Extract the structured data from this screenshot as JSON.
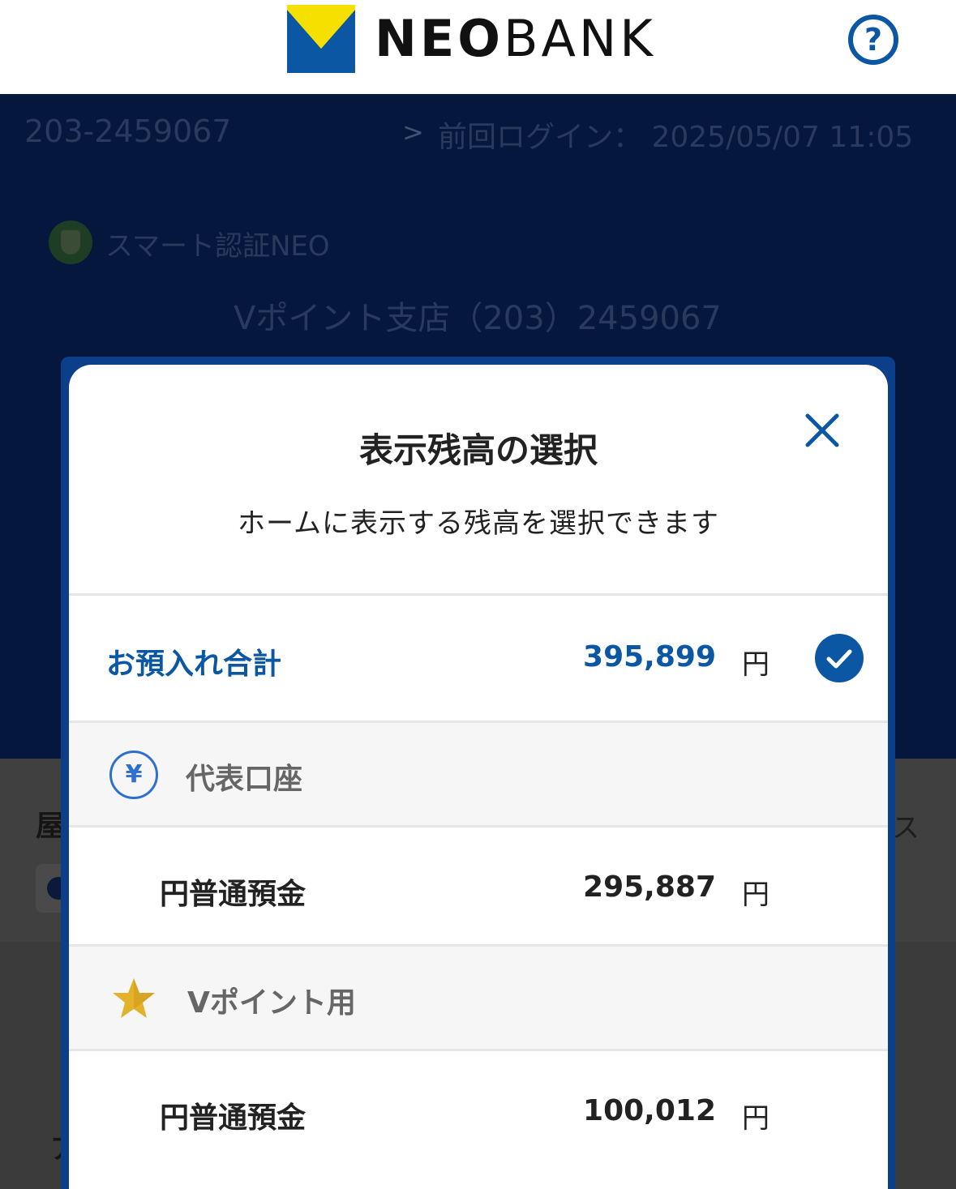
{
  "header": {
    "logo_bold": "NEO",
    "logo_thin": "BANK",
    "help_label": "?"
  },
  "background": {
    "account_number": "203-2459067",
    "last_login_label": "前回ログイン：",
    "last_login_value": "2025/05/07 11:05",
    "smart_auth_label": "スマート認証NEO",
    "branch_label": "Vポイント支店（203）2459067",
    "partial_left_char": "屋",
    "partial_right_char": "ス",
    "partial_left_char2": "ア"
  },
  "modal": {
    "title": "表示残高の選択",
    "subtitle": "ホームに表示する残高を選択できます",
    "total": {
      "label": "お預入れ合計",
      "amount": "395,899",
      "unit": "円",
      "selected": true
    },
    "groups": [
      {
        "label": "代表口座",
        "icon": "yen-circle-icon",
        "item": {
          "label": "円普通預金",
          "amount": "295,887",
          "unit": "円"
        }
      },
      {
        "label": "Vポイント用",
        "icon": "star-icon",
        "item": {
          "label": "円普通預金",
          "amount": "100,012",
          "unit": "円"
        }
      }
    ]
  },
  "colors": {
    "brand_blue": "#0b57a4",
    "logo_yellow": "#f5e000",
    "logo_blue": "#0b57a4",
    "overlay_dark": "#05173d",
    "star_gold": "#e2b22a"
  }
}
